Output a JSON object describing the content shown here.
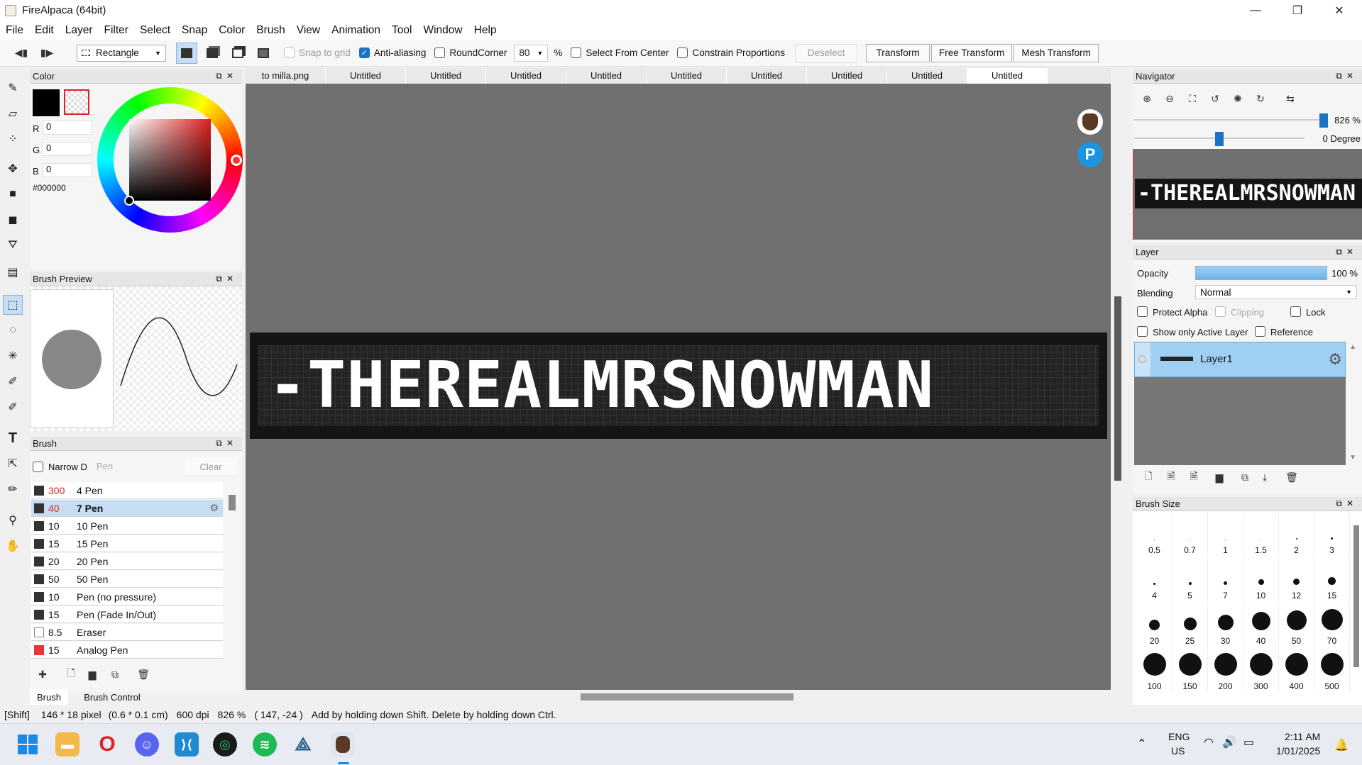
{
  "window": {
    "title": "FireAlpaca (64bit)",
    "minimize": "—",
    "maximize": "❐",
    "close": "✕"
  },
  "menu": [
    "File",
    "Edit",
    "Layer",
    "Filter",
    "Select",
    "Snap",
    "Color",
    "Brush",
    "View",
    "Animation",
    "Tool",
    "Window",
    "Help"
  ],
  "toolbar": {
    "shape_select": "Rectangle",
    "snap_to_grid": "Snap to grid",
    "anti_aliasing": "Anti-aliasing",
    "round_corner": "RoundCorner",
    "round_corner_value": "80",
    "percent": "%",
    "select_from_center": "Select From Center",
    "constrain_proportions": "Constrain Proportions",
    "deselect": "Deselect",
    "transform": "Transform",
    "free_transform": "Free Transform",
    "mesh_transform": "Mesh Transform"
  },
  "color_panel": {
    "title": "Color",
    "r_label": "R",
    "g_label": "G",
    "b_label": "B",
    "r": "0",
    "g": "0",
    "b": "0",
    "hex": "#000000",
    "primary": "#000000"
  },
  "brush_preview": {
    "title": "Brush Preview"
  },
  "brush_panel": {
    "title": "Brush",
    "narrow_label": "Narrow D",
    "filter_placeholder": "Pen",
    "clear": "Clear",
    "items": [
      {
        "size": "300",
        "name": "4 Pen",
        "color": "#333333",
        "size_color": "#e02020"
      },
      {
        "size": "40",
        "name": "7 Pen",
        "color": "#333333",
        "size_color": "#e02020",
        "selected": true
      },
      {
        "size": "10",
        "name": "10 Pen",
        "color": "#333333"
      },
      {
        "size": "15",
        "name": "15 Pen",
        "color": "#333333"
      },
      {
        "size": "20",
        "name": "20 Pen",
        "color": "#333333"
      },
      {
        "size": "50",
        "name": "50 Pen",
        "color": "#333333"
      },
      {
        "size": "10",
        "name": "Pen (no pressure)",
        "color": "#333333"
      },
      {
        "size": "15",
        "name": "Pen (Fade In/Out)",
        "color": "#333333"
      },
      {
        "size": "8.5",
        "name": "Eraser",
        "color": "#ffffff"
      },
      {
        "size": "15",
        "name": "Analog Pen",
        "color": "#ee3333"
      }
    ],
    "tab_brush": "Brush",
    "tab_brush_control": "Brush Control"
  },
  "tabs": [
    "to milla.png",
    "Untitled",
    "Untitled",
    "Untitled",
    "Untitled",
    "Untitled",
    "Untitled",
    "Untitled",
    "Untitled",
    "Untitled"
  ],
  "canvas_text": "-THEREALMRSNOWMAN",
  "navigator": {
    "title": "Navigator",
    "zoom": "826 %",
    "rotation": "0 Degree",
    "zoom_fraction": 0.99,
    "rotation_fraction": 0.5
  },
  "layer_panel": {
    "title": "Layer",
    "opacity_label": "Opacity",
    "opacity_value": "100 %",
    "blending_label": "Blending",
    "blending_value": "Normal",
    "protect_alpha": "Protect Alpha",
    "clipping": "Clipping",
    "lock": "Lock",
    "show_only_active": "Show only Active Layer",
    "reference": "Reference",
    "layers": [
      {
        "name": "Layer1"
      }
    ]
  },
  "brush_size": {
    "title": "Brush Size",
    "sizes": [
      "0.5",
      "0.7",
      "1",
      "1.5",
      "2",
      "3",
      "4",
      "5",
      "7",
      "10",
      "12",
      "15",
      "20",
      "25",
      "30",
      "40",
      "50",
      "70",
      "100",
      "150",
      "200",
      "300",
      "400",
      "500"
    ]
  },
  "statusbar": {
    "key": "[Shift]",
    "pixels": "146 * 18 pixel",
    "cm": "(0.6 * 0.1 cm)",
    "dpi": "600 dpi",
    "zoom": "826 %",
    "coords": "( 147, -24 )",
    "hint": "Add by holding down Shift. Delete by holding down Ctrl."
  },
  "taskbar": {
    "lang": "ENG",
    "region": "US",
    "time": "2:11 AM",
    "date": "1/01/2025"
  }
}
